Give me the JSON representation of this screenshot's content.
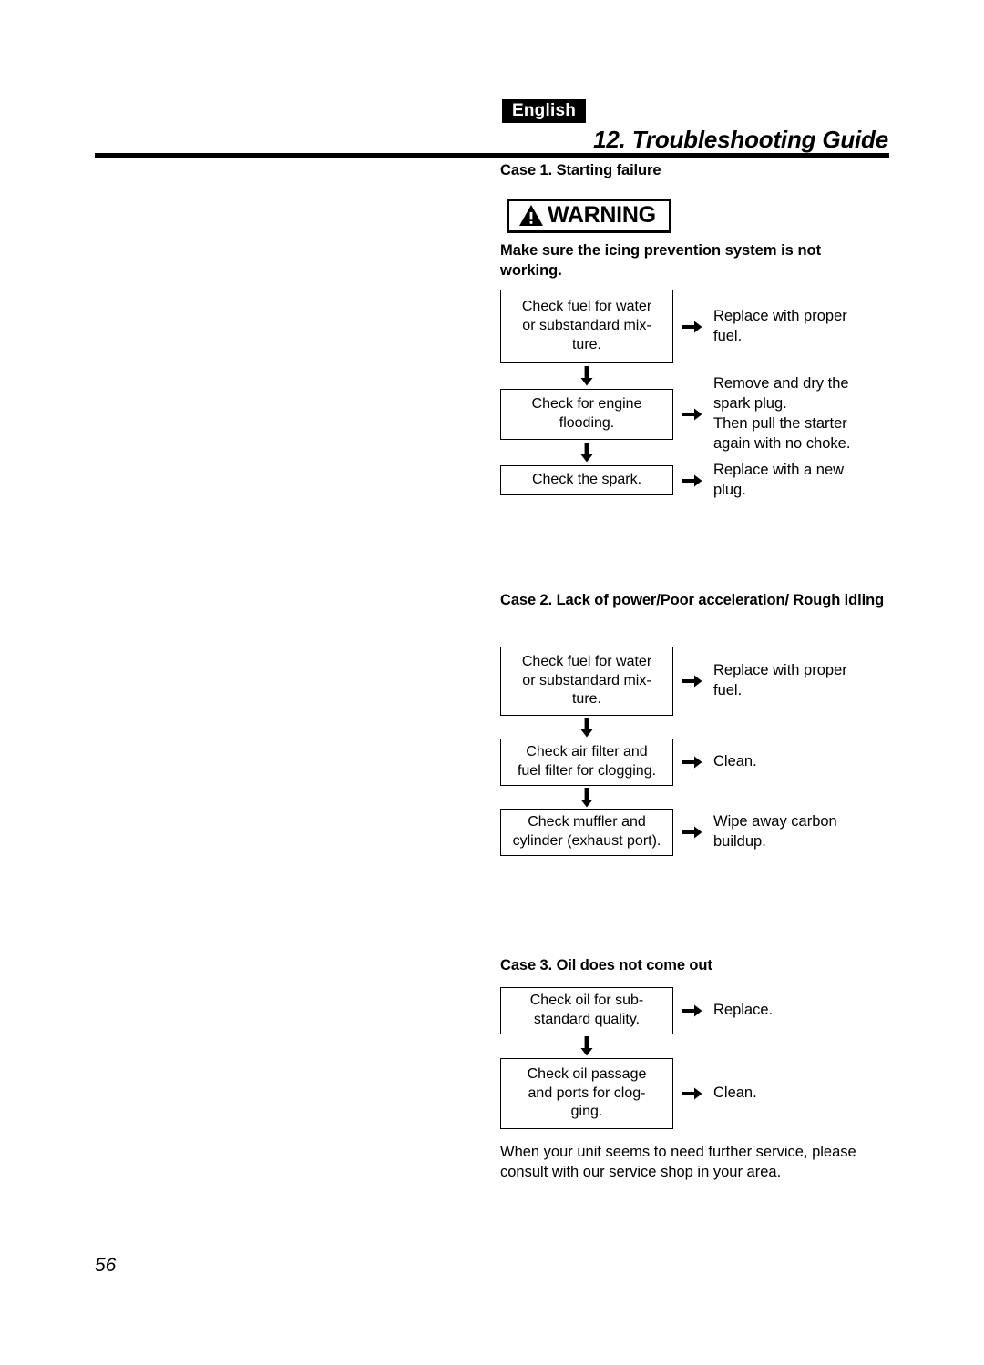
{
  "header": {
    "language_tag": "English",
    "chapter_title": "12. Troubleshooting Guide"
  },
  "warning": {
    "label": "WARNING",
    "icon": "warning-triangle-icon",
    "text_line1": "Make sure the icing prevention system is not",
    "text_line2": "working."
  },
  "cases": [
    {
      "heading": "Case 1. Starting failure",
      "steps": [
        {
          "check": "Check fuel for water or substandard mix-ture.",
          "check_lines": [
            "Check fuel for water",
            "or substandard mix-",
            "ture."
          ],
          "action_lines": [
            "Replace with proper",
            "fuel."
          ]
        },
        {
          "check": "Check for engine flooding.",
          "check_lines": [
            "Check for engine",
            "flooding."
          ],
          "action_lines": [
            "Remove and dry the",
            "spark plug.",
            "Then pull the starter",
            "again with no choke."
          ]
        },
        {
          "check": "Check the spark.",
          "check_lines": [
            "Check the spark."
          ],
          "action_lines": [
            "Replace with a new",
            "plug."
          ]
        }
      ]
    },
    {
      "heading": "Case 2. Lack of power/Poor acceleration/ Rough idling",
      "steps": [
        {
          "check": "Check fuel for water or substandard mix-ture.",
          "check_lines": [
            "Check fuel for water",
            "or substandard mix-",
            "ture."
          ],
          "action_lines": [
            "Replace with proper",
            "fuel."
          ]
        },
        {
          "check": "Check air filter and fuel filter for clogging.",
          "check_lines": [
            "Check air filter and",
            "fuel filter for clogging."
          ],
          "action_lines": [
            "Clean."
          ]
        },
        {
          "check": "Check muffler and cylinder (exhaust port).",
          "check_lines": [
            "Check muffler and",
            "cylinder (exhaust port)."
          ],
          "action_lines": [
            "Wipe away carbon",
            "buildup."
          ]
        }
      ]
    },
    {
      "heading": "Case 3. Oil does not come out",
      "steps": [
        {
          "check": "Check oil for sub-standard quality.",
          "check_lines": [
            "Check oil for sub-",
            "standard quality."
          ],
          "action_lines": [
            "Replace."
          ]
        },
        {
          "check": "Check oil passage and ports for clog-ging.",
          "check_lines": [
            "Check oil passage",
            "and ports for clog-",
            "ging."
          ],
          "action_lines": [
            "Clean."
          ]
        }
      ]
    }
  ],
  "closing": {
    "line1": "When your unit seems to need further service, please",
    "line2": "consult with our service shop in your area."
  },
  "footer": {
    "page_number": "56"
  },
  "colors": {
    "ink": "#000000",
    "paper": "#ffffff"
  }
}
